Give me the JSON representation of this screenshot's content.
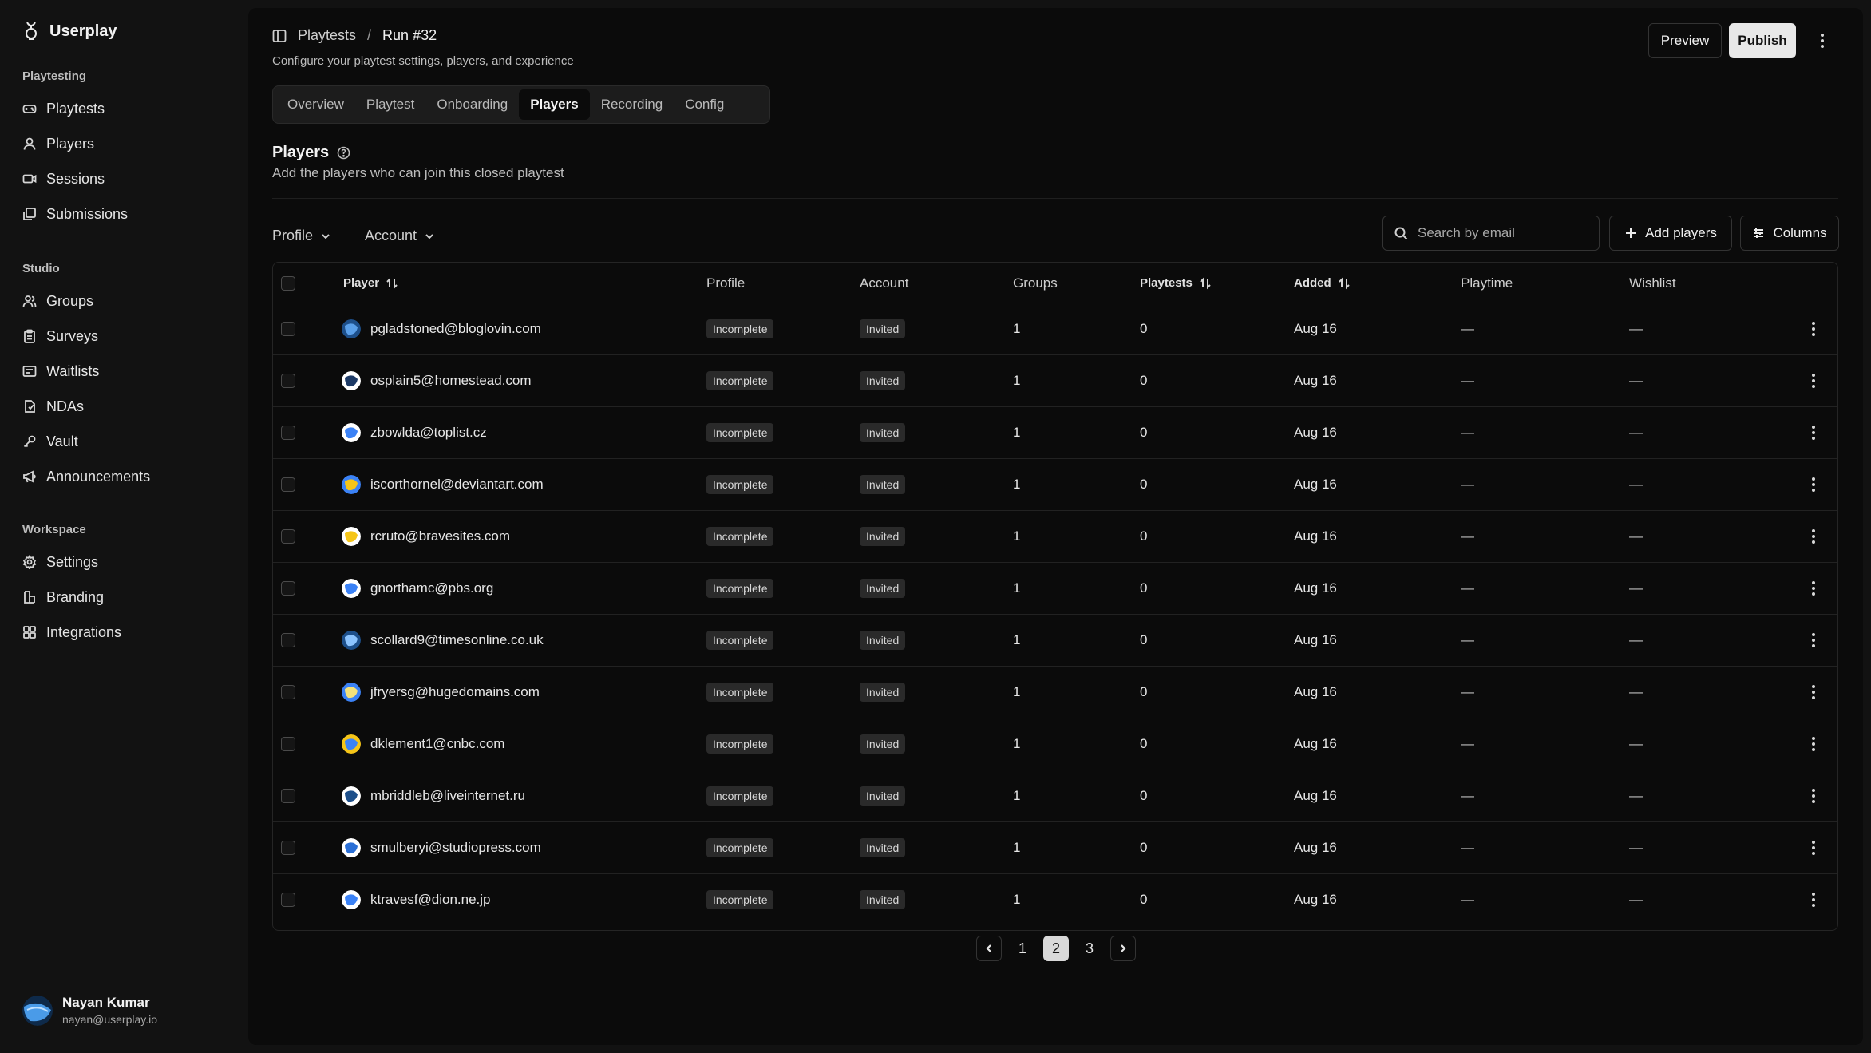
{
  "app": {
    "name": "Userplay"
  },
  "sidebar": {
    "sections": [
      {
        "label": "Playtesting",
        "items": [
          {
            "label": "Playtests",
            "icon": "gamepad-icon"
          },
          {
            "label": "Players",
            "icon": "user-icon"
          },
          {
            "label": "Sessions",
            "icon": "video-icon"
          },
          {
            "label": "Submissions",
            "icon": "stack-icon"
          }
        ]
      },
      {
        "label": "Studio",
        "items": [
          {
            "label": "Groups",
            "icon": "users-icon"
          },
          {
            "label": "Surveys",
            "icon": "clipboard-icon"
          },
          {
            "label": "Waitlists",
            "icon": "list-icon"
          },
          {
            "label": "NDAs",
            "icon": "document-icon"
          },
          {
            "label": "Vault",
            "icon": "key-icon"
          },
          {
            "label": "Announcements",
            "icon": "megaphone-icon"
          }
        ]
      },
      {
        "label": "Workspace",
        "items": [
          {
            "label": "Settings",
            "icon": "gear-icon"
          },
          {
            "label": "Branding",
            "icon": "brush-icon"
          },
          {
            "label": "Integrations",
            "icon": "puzzle-icon"
          }
        ]
      }
    ],
    "user": {
      "name": "Nayan Kumar",
      "email": "nayan@userplay.io"
    }
  },
  "header": {
    "breadcrumb": [
      "Playtests",
      "Run #32"
    ],
    "separator": "/",
    "subtitle": "Configure your playtest settings, players, and experience",
    "preview_label": "Preview",
    "publish_label": "Publish"
  },
  "tabs": [
    "Overview",
    "Playtest",
    "Onboarding",
    "Players",
    "Recording",
    "Config"
  ],
  "active_tab": "Players",
  "section": {
    "title": "Players",
    "description": "Add the players who can join this closed playtest"
  },
  "filters": {
    "profile_label": "Profile",
    "account_label": "Account"
  },
  "search": {
    "placeholder": "Search by email"
  },
  "actions": {
    "add_players_label": "Add players",
    "columns_label": "Columns"
  },
  "table": {
    "columns": {
      "player": "Player",
      "profile": "Profile",
      "account": "Account",
      "groups": "Groups",
      "playtests": "Playtests",
      "added": "Added",
      "playtime": "Playtime",
      "wishlist": "Wishlist"
    },
    "rows": [
      {
        "email": "pgladstoned@bloglovin.com",
        "profile": "Incomplete",
        "account": "Invited",
        "groups": "1",
        "playtests": "0",
        "added": "Aug 16",
        "playtime": "—",
        "wishlist": "—"
      },
      {
        "email": "osplain5@homestead.com",
        "profile": "Incomplete",
        "account": "Invited",
        "groups": "1",
        "playtests": "0",
        "added": "Aug 16",
        "playtime": "—",
        "wishlist": "—"
      },
      {
        "email": "zbowlda@toplist.cz",
        "profile": "Incomplete",
        "account": "Invited",
        "groups": "1",
        "playtests": "0",
        "added": "Aug 16",
        "playtime": "—",
        "wishlist": "—"
      },
      {
        "email": "iscorthornel@deviantart.com",
        "profile": "Incomplete",
        "account": "Invited",
        "groups": "1",
        "playtests": "0",
        "added": "Aug 16",
        "playtime": "—",
        "wishlist": "—"
      },
      {
        "email": "rcruto@bravesites.com",
        "profile": "Incomplete",
        "account": "Invited",
        "groups": "1",
        "playtests": "0",
        "added": "Aug 16",
        "playtime": "—",
        "wishlist": "—"
      },
      {
        "email": "gnorthamc@pbs.org",
        "profile": "Incomplete",
        "account": "Invited",
        "groups": "1",
        "playtests": "0",
        "added": "Aug 16",
        "playtime": "—",
        "wishlist": "—"
      },
      {
        "email": "scollard9@timesonline.co.uk",
        "profile": "Incomplete",
        "account": "Invited",
        "groups": "1",
        "playtests": "0",
        "added": "Aug 16",
        "playtime": "—",
        "wishlist": "—"
      },
      {
        "email": "jfryersg@hugedomains.com",
        "profile": "Incomplete",
        "account": "Invited",
        "groups": "1",
        "playtests": "0",
        "added": "Aug 16",
        "playtime": "—",
        "wishlist": "—"
      },
      {
        "email": "dklement1@cnbc.com",
        "profile": "Incomplete",
        "account": "Invited",
        "groups": "1",
        "playtests": "0",
        "added": "Aug 16",
        "playtime": "—",
        "wishlist": "—"
      },
      {
        "email": "mbriddleb@liveinternet.ru",
        "profile": "Incomplete",
        "account": "Invited",
        "groups": "1",
        "playtests": "0",
        "added": "Aug 16",
        "playtime": "—",
        "wishlist": "—"
      },
      {
        "email": "smulberyi@studiopress.com",
        "profile": "Incomplete",
        "account": "Invited",
        "groups": "1",
        "playtests": "0",
        "added": "Aug 16",
        "playtime": "—",
        "wishlist": "—"
      },
      {
        "email": "ktravesf@dion.ne.jp",
        "profile": "Incomplete",
        "account": "Invited",
        "groups": "1",
        "playtests": "0",
        "added": "Aug 16",
        "playtime": "—",
        "wishlist": "—"
      }
    ]
  },
  "pagination": {
    "pages": [
      "1",
      "2",
      "3"
    ],
    "current": "2"
  },
  "colors": {
    "accent_blue": "#3b82f6",
    "avatar_yellow": "#f5c518",
    "background": "#0b0b0b",
    "sidebar": "#121212"
  }
}
